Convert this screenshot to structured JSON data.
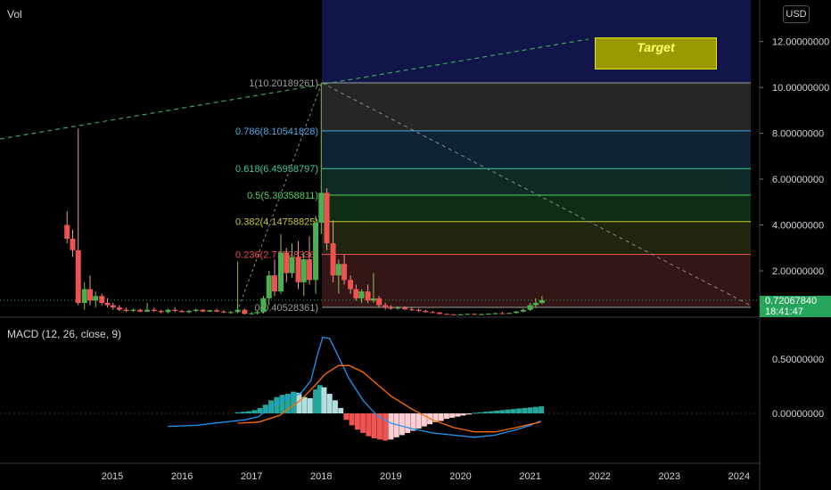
{
  "header": {
    "vol_label": "Vol",
    "currency_button": "USD"
  },
  "macd": {
    "label": "MACD (12, 26, close, 9)"
  },
  "price_tag": {
    "value": "0.72067840",
    "time": "18:41:47"
  },
  "target_label": "Target",
  "fib_levels": [
    {
      "label": "1(10.20189261)",
      "value": 10.20189261,
      "color": "#9e9e9e",
      "fill": "#2a2a2a"
    },
    {
      "label": "0.786(8.10541828)",
      "value": 8.10541828,
      "color": "#4fa8e8",
      "fill": "#10283a"
    },
    {
      "label": "0.618(6.45958797)",
      "value": 6.45958797,
      "color": "#39c9a0",
      "fill": "#0e2f2a"
    },
    {
      "label": "0.5(5.30358811)",
      "value": 5.30358811,
      "color": "#4cd15e",
      "fill": "#0f3315"
    },
    {
      "label": "0.382(4.14758825)",
      "value": 4.14758825,
      "color": "#c8c832",
      "fill": "#222910"
    },
    {
      "label": "0.236(2.71728336)",
      "value": 2.71728336,
      "color": "#e84f4f",
      "fill": "#3a1818"
    },
    {
      "label": "0(0.40528361)",
      "value": 0.40528361,
      "color": "#9e9e9e",
      "fill": "#3a1818"
    }
  ],
  "chart_data": {
    "type": "candlestick",
    "price_axis": {
      "ticks": [
        "12.00000000",
        "10.00000000",
        "8.00000000",
        "6.00000000",
        "4.00000000",
        "2.00000000"
      ],
      "tick_values": [
        12,
        10,
        8,
        6,
        4,
        2
      ],
      "ylim": [
        0,
        13
      ]
    },
    "macd_axis": {
      "ticks": [
        "0.50000000",
        "0.00000000"
      ],
      "tick_values": [
        0.5,
        0.0
      ],
      "ylim": [
        -0.2,
        0.8
      ]
    },
    "x_axis": {
      "ticks": [
        "2015",
        "2016",
        "2017",
        "2018",
        "2019",
        "2020",
        "2021",
        "2022",
        "2023",
        "2024"
      ],
      "tick_years": [
        2015,
        2016,
        2017,
        2018,
        2019,
        2020,
        2021,
        2022,
        2023,
        2024
      ]
    },
    "candles": [
      [
        2014.35,
        4.0,
        4.6,
        3.2,
        3.4
      ],
      [
        2014.43,
        3.4,
        3.8,
        2.6,
        2.9
      ],
      [
        2014.51,
        2.9,
        8.2,
        0.5,
        0.6
      ],
      [
        2014.6,
        0.6,
        1.5,
        0.3,
        1.2
      ],
      [
        2014.68,
        1.2,
        1.8,
        0.5,
        0.7
      ],
      [
        2014.76,
        0.7,
        1.1,
        0.4,
        0.9
      ],
      [
        2014.85,
        0.9,
        1.0,
        0.5,
        0.6
      ],
      [
        2014.93,
        0.6,
        0.8,
        0.4,
        0.5
      ],
      [
        2015.01,
        0.5,
        0.6,
        0.3,
        0.4
      ],
      [
        2015.1,
        0.4,
        0.5,
        0.25,
        0.3
      ],
      [
        2015.2,
        0.3,
        0.4,
        0.2,
        0.25
      ],
      [
        2015.3,
        0.25,
        0.35,
        0.2,
        0.3
      ],
      [
        2015.4,
        0.3,
        0.35,
        0.2,
        0.22
      ],
      [
        2015.5,
        0.22,
        0.6,
        0.2,
        0.3
      ],
      [
        2015.6,
        0.3,
        0.4,
        0.2,
        0.25
      ],
      [
        2015.7,
        0.25,
        0.3,
        0.15,
        0.2
      ],
      [
        2015.8,
        0.2,
        0.35,
        0.15,
        0.3
      ],
      [
        2015.9,
        0.3,
        0.4,
        0.2,
        0.25
      ],
      [
        2016.0,
        0.25,
        0.3,
        0.18,
        0.2
      ],
      [
        2016.1,
        0.2,
        0.3,
        0.15,
        0.25
      ],
      [
        2016.2,
        0.25,
        0.35,
        0.2,
        0.3
      ],
      [
        2016.3,
        0.3,
        0.32,
        0.2,
        0.22
      ],
      [
        2016.4,
        0.22,
        0.3,
        0.2,
        0.28
      ],
      [
        2016.5,
        0.28,
        0.35,
        0.2,
        0.22
      ],
      [
        2016.6,
        0.22,
        0.28,
        0.15,
        0.18
      ],
      [
        2016.7,
        0.18,
        0.25,
        0.12,
        0.2
      ],
      [
        2016.8,
        0.2,
        2.4,
        0.15,
        0.3
      ],
      [
        2016.9,
        0.3,
        0.35,
        0.1,
        0.12
      ],
      [
        2017.0,
        0.12,
        0.2,
        0.08,
        0.15
      ],
      [
        2017.08,
        0.15,
        0.25,
        0.1,
        0.2
      ],
      [
        2017.17,
        0.2,
        0.9,
        0.15,
        0.8
      ],
      [
        2017.25,
        0.8,
        2.0,
        0.5,
        1.8
      ],
      [
        2017.33,
        1.8,
        2.5,
        0.9,
        1.1
      ],
      [
        2017.42,
        1.1,
        3.6,
        1.0,
        2.8
      ],
      [
        2017.5,
        2.8,
        3.0,
        1.5,
        1.9
      ],
      [
        2017.58,
        1.9,
        3.2,
        1.7,
        2.6
      ],
      [
        2017.67,
        2.6,
        3.3,
        1.2,
        1.5
      ],
      [
        2017.75,
        1.5,
        2.8,
        0.9,
        2.5
      ],
      [
        2017.83,
        2.5,
        3.5,
        1.4,
        1.6
      ],
      [
        2017.92,
        1.6,
        4.4,
        1.0,
        4.1
      ],
      [
        2018.0,
        4.1,
        10.2,
        3.6,
        5.4
      ],
      [
        2018.08,
        5.4,
        5.6,
        2.9,
        3.2
      ],
      [
        2018.17,
        3.2,
        4.2,
        1.5,
        1.8
      ],
      [
        2018.25,
        1.8,
        2.5,
        1.0,
        2.3
      ],
      [
        2018.33,
        2.3,
        2.7,
        1.4,
        1.6
      ],
      [
        2018.42,
        1.6,
        1.8,
        1.0,
        1.2
      ],
      [
        2018.5,
        1.2,
        1.4,
        0.7,
        0.8
      ],
      [
        2018.58,
        0.8,
        1.2,
        0.6,
        1.1
      ],
      [
        2018.67,
        1.1,
        1.4,
        0.6,
        0.7
      ],
      [
        2018.75,
        0.7,
        1.9,
        0.6,
        0.8
      ],
      [
        2018.83,
        0.8,
        0.9,
        0.4,
        0.5
      ],
      [
        2018.92,
        0.5,
        0.6,
        0.3,
        0.4
      ],
      [
        2019.0,
        0.4,
        0.5,
        0.3,
        0.35
      ],
      [
        2019.1,
        0.35,
        0.45,
        0.3,
        0.4
      ],
      [
        2019.2,
        0.4,
        0.45,
        0.3,
        0.32
      ],
      [
        2019.3,
        0.32,
        0.4,
        0.25,
        0.3
      ],
      [
        2019.4,
        0.3,
        0.35,
        0.2,
        0.25
      ],
      [
        2019.5,
        0.25,
        0.3,
        0.18,
        0.2
      ],
      [
        2019.6,
        0.2,
        0.25,
        0.15,
        0.18
      ],
      [
        2019.7,
        0.18,
        0.2,
        0.1,
        0.12
      ],
      [
        2019.8,
        0.12,
        0.15,
        0.08,
        0.1
      ],
      [
        2019.9,
        0.1,
        0.12,
        0.07,
        0.08
      ],
      [
        2020.0,
        0.08,
        0.12,
        0.06,
        0.1
      ],
      [
        2020.1,
        0.1,
        0.14,
        0.08,
        0.12
      ],
      [
        2020.2,
        0.12,
        0.15,
        0.07,
        0.09
      ],
      [
        2020.3,
        0.09,
        0.13,
        0.07,
        0.11
      ],
      [
        2020.4,
        0.11,
        0.15,
        0.09,
        0.13
      ],
      [
        2020.5,
        0.13,
        0.18,
        0.1,
        0.15
      ],
      [
        2020.6,
        0.15,
        0.2,
        0.12,
        0.14
      ],
      [
        2020.7,
        0.14,
        0.18,
        0.11,
        0.16
      ],
      [
        2020.8,
        0.16,
        0.25,
        0.13,
        0.22
      ],
      [
        2020.9,
        0.22,
        0.35,
        0.18,
        0.3
      ],
      [
        2021.0,
        0.3,
        0.6,
        0.25,
        0.5
      ],
      [
        2021.08,
        0.5,
        0.8,
        0.4,
        0.6
      ],
      [
        2021.17,
        0.6,
        0.9,
        0.55,
        0.72
      ]
    ],
    "macd_histogram": [
      [
        2016.8,
        0.01
      ],
      [
        2016.88,
        0.015
      ],
      [
        2016.96,
        0.02
      ],
      [
        2017.04,
        0.03
      ],
      [
        2017.12,
        0.05
      ],
      [
        2017.2,
        0.08
      ],
      [
        2017.28,
        0.12
      ],
      [
        2017.36,
        0.15
      ],
      [
        2017.44,
        0.17
      ],
      [
        2017.52,
        0.18
      ],
      [
        2017.6,
        0.2
      ],
      [
        2017.68,
        0.19
      ],
      [
        2017.76,
        0.15
      ],
      [
        2017.84,
        0.14
      ],
      [
        2017.92,
        0.22
      ],
      [
        2017.98,
        0.26
      ],
      [
        2018.04,
        0.24
      ],
      [
        2018.12,
        0.18
      ],
      [
        2018.2,
        0.12
      ],
      [
        2018.28,
        0.05
      ],
      [
        2018.36,
        -0.06
      ],
      [
        2018.44,
        -0.11
      ],
      [
        2018.52,
        -0.15
      ],
      [
        2018.6,
        -0.18
      ],
      [
        2018.68,
        -0.21
      ],
      [
        2018.76,
        -0.23
      ],
      [
        2018.84,
        -0.24
      ],
      [
        2018.92,
        -0.25
      ],
      [
        2019.0,
        -0.24
      ],
      [
        2019.08,
        -0.22
      ],
      [
        2019.16,
        -0.2
      ],
      [
        2019.24,
        -0.18
      ],
      [
        2019.32,
        -0.16
      ],
      [
        2019.4,
        -0.14
      ],
      [
        2019.48,
        -0.12
      ],
      [
        2019.56,
        -0.1
      ],
      [
        2019.64,
        -0.08
      ],
      [
        2019.72,
        -0.07
      ],
      [
        2019.8,
        -0.05
      ],
      [
        2019.88,
        -0.04
      ],
      [
        2019.96,
        -0.03
      ],
      [
        2020.04,
        -0.02
      ],
      [
        2020.12,
        -0.01
      ],
      [
        2020.2,
        0.005
      ],
      [
        2020.28,
        0.01
      ],
      [
        2020.36,
        0.015
      ],
      [
        2020.44,
        0.02
      ],
      [
        2020.52,
        0.025
      ],
      [
        2020.6,
        0.03
      ],
      [
        2020.68,
        0.035
      ],
      [
        2020.76,
        0.04
      ],
      [
        2020.84,
        0.045
      ],
      [
        2020.92,
        0.05
      ],
      [
        2021.0,
        0.055
      ],
      [
        2021.08,
        0.06
      ],
      [
        2021.16,
        0.065
      ]
    ],
    "macd_line": [
      [
        2015.8,
        -0.12
      ],
      [
        2016.2,
        -0.11
      ],
      [
        2016.6,
        -0.08
      ],
      [
        2016.9,
        -0.06
      ],
      [
        2017.1,
        -0.03
      ],
      [
        2017.3,
        0.07
      ],
      [
        2017.5,
        0.14
      ],
      [
        2017.7,
        0.18
      ],
      [
        2017.85,
        0.3
      ],
      [
        2017.95,
        0.55
      ],
      [
        2018.02,
        0.7
      ],
      [
        2018.12,
        0.69
      ],
      [
        2018.25,
        0.52
      ],
      [
        2018.4,
        0.32
      ],
      [
        2018.6,
        0.12
      ],
      [
        2018.8,
        -0.02
      ],
      [
        2019.0,
        -0.09
      ],
      [
        2019.3,
        -0.14
      ],
      [
        2019.6,
        -0.18
      ],
      [
        2019.9,
        -0.2
      ],
      [
        2020.2,
        -0.22
      ],
      [
        2020.5,
        -0.2
      ],
      [
        2020.8,
        -0.15
      ],
      [
        2021.0,
        -0.11
      ],
      [
        2021.15,
        -0.07
      ]
    ],
    "signal_line": [
      [
        2016.8,
        -0.09
      ],
      [
        2017.1,
        -0.08
      ],
      [
        2017.4,
        -0.02
      ],
      [
        2017.7,
        0.12
      ],
      [
        2017.9,
        0.25
      ],
      [
        2018.05,
        0.36
      ],
      [
        2018.25,
        0.44
      ],
      [
        2018.4,
        0.44
      ],
      [
        2018.6,
        0.38
      ],
      [
        2018.8,
        0.27
      ],
      [
        2019.0,
        0.16
      ],
      [
        2019.3,
        0.04
      ],
      [
        2019.6,
        -0.06
      ],
      [
        2019.9,
        -0.13
      ],
      [
        2020.2,
        -0.17
      ],
      [
        2020.5,
        -0.17
      ],
      [
        2020.8,
        -0.13
      ],
      [
        2021.0,
        -0.1
      ],
      [
        2021.15,
        -0.08
      ]
    ]
  }
}
